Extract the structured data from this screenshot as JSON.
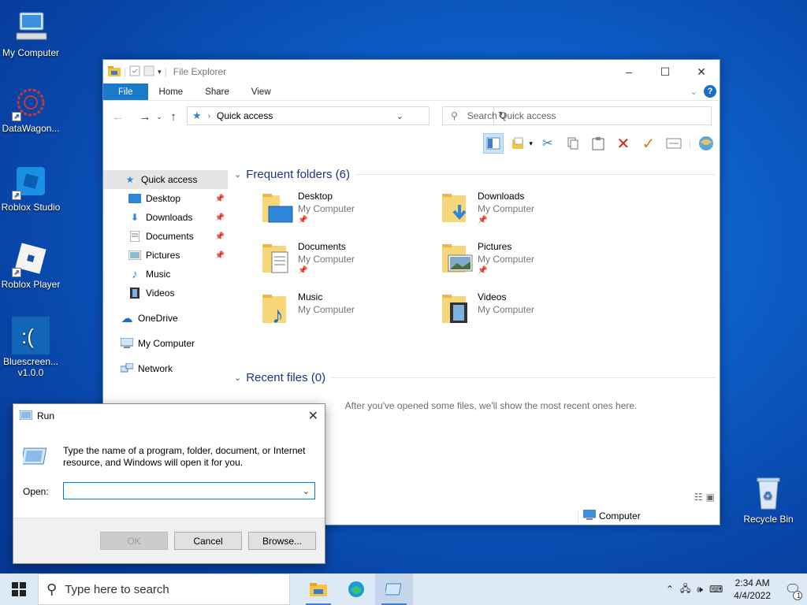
{
  "desktop": {
    "icons": [
      {
        "label": "My Computer"
      },
      {
        "label": "DataWagon..."
      },
      {
        "label": "Roblox Studio"
      },
      {
        "label": "Roblox Player"
      },
      {
        "label": "Bluescreen...\nv1.0.0"
      },
      {
        "label": "Recycle Bin"
      }
    ]
  },
  "explorer": {
    "title": "File Explorer",
    "ribbon_tabs": [
      "File",
      "Home",
      "Share",
      "View"
    ],
    "address": "Quick access",
    "search_placeholder": "Search Quick access",
    "nav": [
      {
        "label": "Quick access",
        "icon": "star-icon",
        "selected": true
      },
      {
        "label": "Desktop",
        "icon": "desktop-icon",
        "pinned": true
      },
      {
        "label": "Downloads",
        "icon": "download-icon",
        "pinned": true
      },
      {
        "label": "Documents",
        "icon": "document-icon",
        "pinned": true
      },
      {
        "label": "Pictures",
        "icon": "picture-icon",
        "pinned": true
      },
      {
        "label": "Music",
        "icon": "music-icon"
      },
      {
        "label": "Videos",
        "icon": "video-icon"
      },
      {
        "label": "OneDrive",
        "icon": "cloud-icon"
      },
      {
        "label": "My Computer",
        "icon": "computer-icon"
      },
      {
        "label": "Network",
        "icon": "network-icon"
      }
    ],
    "frequent_header": "Frequent folders (6)",
    "folders": [
      {
        "name": "Desktop",
        "location": "My Computer",
        "pinned": true
      },
      {
        "name": "Downloads",
        "location": "My Computer",
        "pinned": true
      },
      {
        "name": "Documents",
        "location": "My Computer",
        "pinned": true
      },
      {
        "name": "Pictures",
        "location": "My Computer",
        "pinned": true
      },
      {
        "name": "Music",
        "location": "My Computer"
      },
      {
        "name": "Videos",
        "location": "My Computer"
      }
    ],
    "recent_header": "Recent files (0)",
    "recent_empty": "After you've opened some files, we'll show the most recent ones here.",
    "status_location": "Computer"
  },
  "run_dialog": {
    "title": "Run",
    "message": "Type the name of a program, folder, document, or Internet resource, and Windows will open it for you.",
    "open_label": "Open:",
    "open_value": "",
    "ok": "OK",
    "cancel": "Cancel",
    "browse": "Browse..."
  },
  "taskbar": {
    "search_placeholder": "Type here to search",
    "time": "2:34 AM",
    "date": "4/4/2022",
    "notification_count": "1"
  }
}
